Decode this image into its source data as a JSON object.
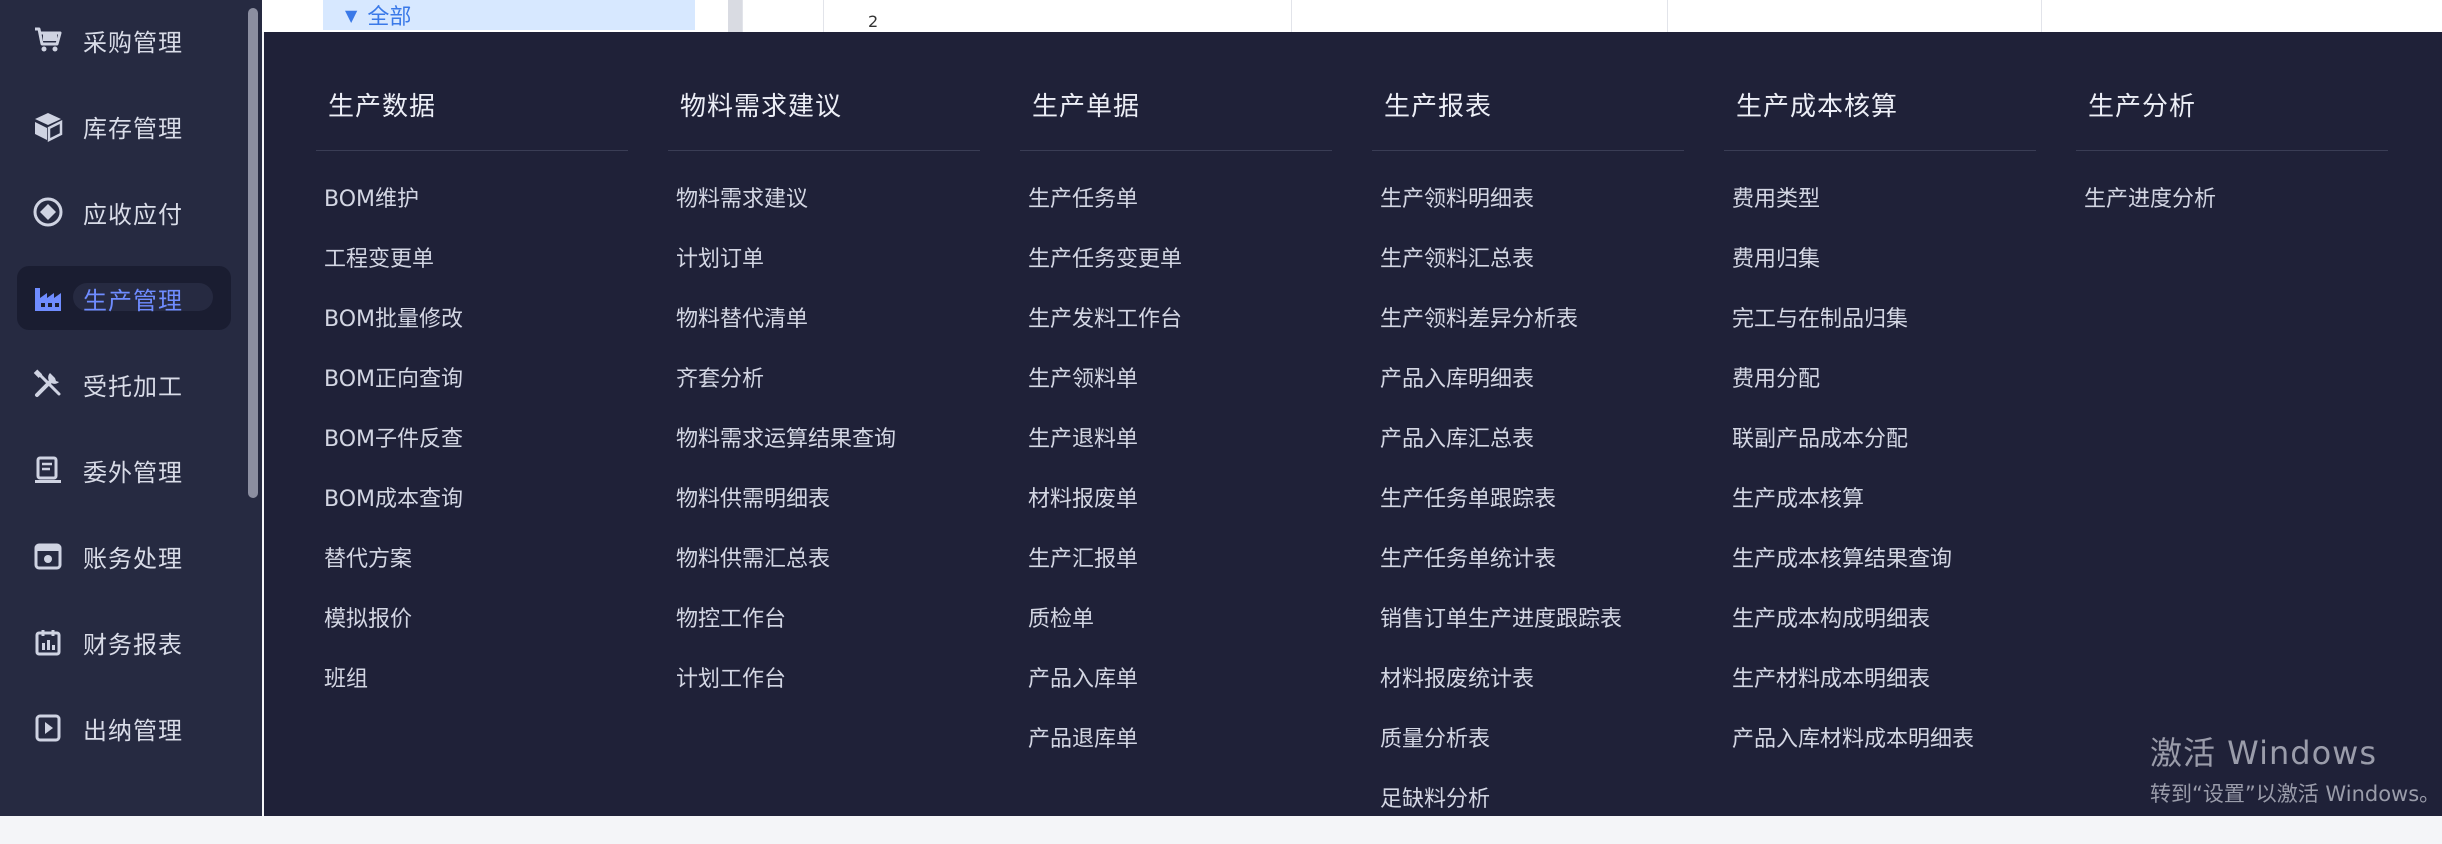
{
  "sidebar": {
    "items": [
      {
        "label": "采购管理",
        "icon": "cart-icon",
        "active": false
      },
      {
        "label": "库存管理",
        "icon": "box-icon",
        "active": false
      },
      {
        "label": "应收应付",
        "icon": "diamond-icon",
        "active": false
      },
      {
        "label": "生产管理",
        "icon": "factory-icon",
        "active": true
      },
      {
        "label": "受托加工",
        "icon": "tools-icon",
        "active": false
      },
      {
        "label": "委外管理",
        "icon": "outsource-icon",
        "active": false
      },
      {
        "label": "账务处理",
        "icon": "ledger-icon",
        "active": false
      },
      {
        "label": "财务报表",
        "icon": "report-icon",
        "active": false
      },
      {
        "label": "出纳管理",
        "icon": "cashier-icon",
        "active": false
      }
    ]
  },
  "background": {
    "tree_node": "全部",
    "row_number": "2"
  },
  "menu": {
    "columns": [
      {
        "title": "生产数据",
        "items": [
          "BOM维护",
          "工程变更单",
          "BOM批量修改",
          "BOM正向查询",
          "BOM子件反查",
          "BOM成本查询",
          "替代方案",
          "模拟报价",
          "班组"
        ]
      },
      {
        "title": "物料需求建议",
        "items": [
          "物料需求建议",
          "计划订单",
          "物料替代清单",
          "齐套分析",
          "物料需求运算结果查询",
          "物料供需明细表",
          "物料供需汇总表",
          "物控工作台",
          "计划工作台"
        ]
      },
      {
        "title": "生产单据",
        "items": [
          "生产任务单",
          "生产任务变更单",
          "生产发料工作台",
          "生产领料单",
          "生产退料单",
          "材料报废单",
          "生产汇报单",
          "质检单",
          "产品入库单",
          "产品退库单"
        ]
      },
      {
        "title": "生产报表",
        "items": [
          "生产领料明细表",
          "生产领料汇总表",
          "生产领料差异分析表",
          "产品入库明细表",
          "产品入库汇总表",
          "生产任务单跟踪表",
          "生产任务单统计表",
          "销售订单生产进度跟踪表",
          "材料报废统计表",
          "质量分析表",
          "足缺料分析"
        ]
      },
      {
        "title": "生产成本核算",
        "items": [
          "费用类型",
          "费用归集",
          "完工与在制品归集",
          "费用分配",
          "联副产品成本分配",
          "生产成本核算",
          "生产成本核算结果查询",
          "生产成本构成明细表",
          "生产材料成本明细表",
          "产品入库材料成本明细表"
        ]
      },
      {
        "title": "生产分析",
        "items": [
          "生产进度分析"
        ]
      }
    ]
  },
  "watermark": {
    "line1": "激活 Windows",
    "line2": "转到“设置”以激活 Windows。"
  }
}
